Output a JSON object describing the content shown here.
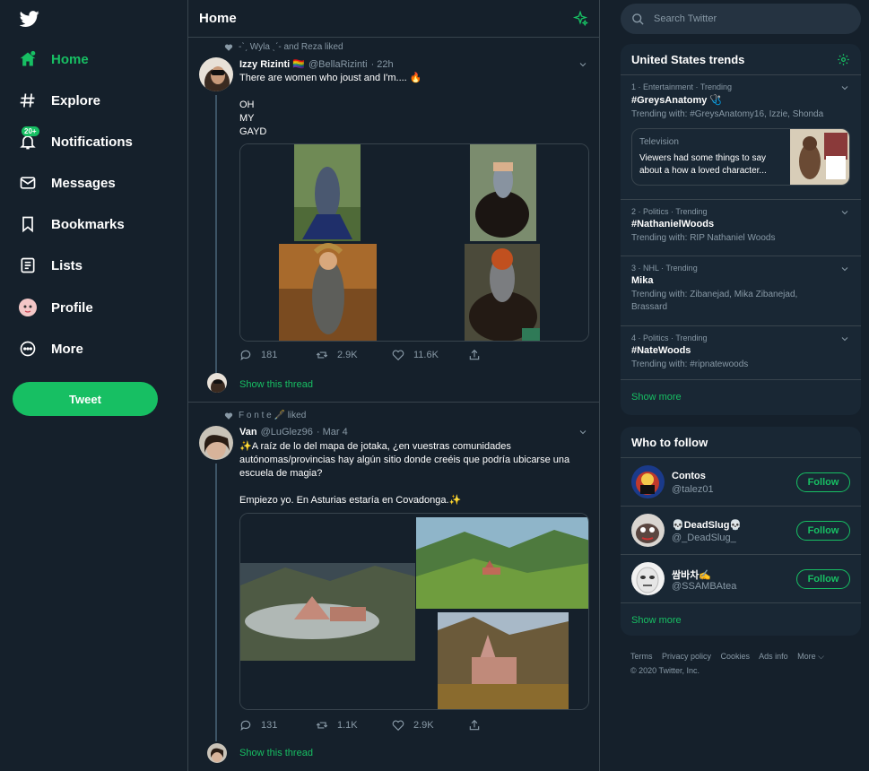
{
  "nav": {
    "items": [
      {
        "label": "Home",
        "icon": "home-icon",
        "active": true
      },
      {
        "label": "Explore",
        "icon": "hashtag-icon"
      },
      {
        "label": "Notifications",
        "icon": "bell-icon",
        "badge": "20+"
      },
      {
        "label": "Messages",
        "icon": "envelope-icon"
      },
      {
        "label": "Bookmarks",
        "icon": "bookmark-icon"
      },
      {
        "label": "Lists",
        "icon": "list-icon"
      },
      {
        "label": "Profile",
        "icon": "profile-avatar"
      },
      {
        "label": "More",
        "icon": "more-circle-icon"
      }
    ],
    "tweet_button": "Tweet"
  },
  "main": {
    "title": "Home",
    "tweets": [
      {
        "social_context": "-ˋˏ Wyla ˎˊ- and Reza liked",
        "name": "Izzy Rizinti 🏳️‍🌈",
        "handle": "@BellaRizinti",
        "time": "· 22h",
        "text": "There are women who joust and I'm....  🔥\n\nOH\nMY\nGAYD",
        "replies": "181",
        "retweets": "2.9K",
        "likes": "11.6K",
        "show_thread": "Show this thread"
      },
      {
        "social_context": "F o n t e 🖋️ liked",
        "name": "Van",
        "handle": "@LuGlez96",
        "time": "· Mar 4",
        "text": "✨A raíz de lo del mapa de jotaka, ¿en vuestras comunidades autónomas/provincias hay algún sitio donde creéis que podría ubicarse una escuela de magia?\n\nEmpiezo yo. En Asturias estaría en Covadonga.✨",
        "replies": "131",
        "retweets": "1.1K",
        "likes": "2.9K",
        "show_thread": "Show this thread"
      }
    ]
  },
  "search": {
    "placeholder": "Search Twitter"
  },
  "trends": {
    "title": "United States trends",
    "items": [
      {
        "category": "1 · Entertainment · Trending",
        "name": "#GreysAnatomy 🩺",
        "with": "Trending with: #GreysAnatomy16, Izzie, Shonda",
        "card": {
          "label": "Television",
          "text": "Viewers had some things to say about a how a loved character..."
        }
      },
      {
        "category": "2 · Politics · Trending",
        "name": "#NathanielWoods",
        "with": "Trending with: RIP Nathaniel Woods"
      },
      {
        "category": "3 · NHL · Trending",
        "name": "Mika",
        "with": "Trending with: Zibanejad, Mika Zibanejad, Brassard"
      },
      {
        "category": "4 · Politics · Trending",
        "name": "#NateWoods",
        "with": "Trending with: #ripnatewoods"
      }
    ],
    "show_more": "Show more"
  },
  "who_to_follow": {
    "title": "Who to follow",
    "users": [
      {
        "name": "Contos",
        "handle": "@talez01",
        "button": "Follow"
      },
      {
        "name": "💀DeadSlug💀",
        "handle": "@_DeadSlug_",
        "button": "Follow"
      },
      {
        "name": "쌈바차✍️",
        "handle": "@SSAMBAtea",
        "button": "Follow"
      }
    ],
    "show_more": "Show more"
  },
  "footer": {
    "links": [
      "Terms",
      "Privacy policy",
      "Cookies",
      "Ads info",
      "More ⌵"
    ],
    "copyright": "© 2020 Twitter, Inc."
  },
  "colors": {
    "accent": "#17bf63",
    "background": "#15202b",
    "panel": "#192734",
    "border": "#38444d",
    "muted": "#8899a6"
  }
}
